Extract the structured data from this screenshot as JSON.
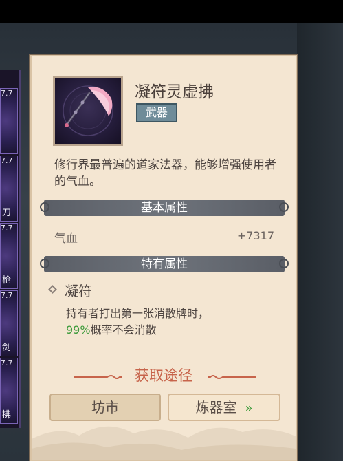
{
  "side_slots": [
    {
      "num": "7.7",
      "label": ""
    },
    {
      "num": "7.7",
      "label": "刀"
    },
    {
      "num": "7.7",
      "label": "枪"
    },
    {
      "num": "7.7",
      "label": "剑"
    },
    {
      "num": "7.7",
      "label": "拂"
    }
  ],
  "item": {
    "name": "凝符灵虚拂",
    "tag": "武器",
    "description": "修行界最普遍的道家法器，能够增强使用者的气血。",
    "icon": "whisk-icon"
  },
  "basic_attributes": {
    "title": "基本属性",
    "stats": [
      {
        "name": "气血",
        "value": "+7317"
      }
    ]
  },
  "special_attributes": {
    "title": "特有属性",
    "trait_name": "凝符",
    "trait_desc_prefix": "持有者打出第一张消散牌时，",
    "trait_pct": "99%",
    "trait_desc_suffix": "概率不会消散"
  },
  "source": {
    "title": "获取途径",
    "market_label": "坊市",
    "forge_label": "炼器室",
    "forge_arrow": "»"
  },
  "colors": {
    "panel_bg": "#f4e6d2",
    "accent_red": "#c7644b",
    "accent_green": "#3c9a3a",
    "tag_bg": "#6f8c99"
  }
}
